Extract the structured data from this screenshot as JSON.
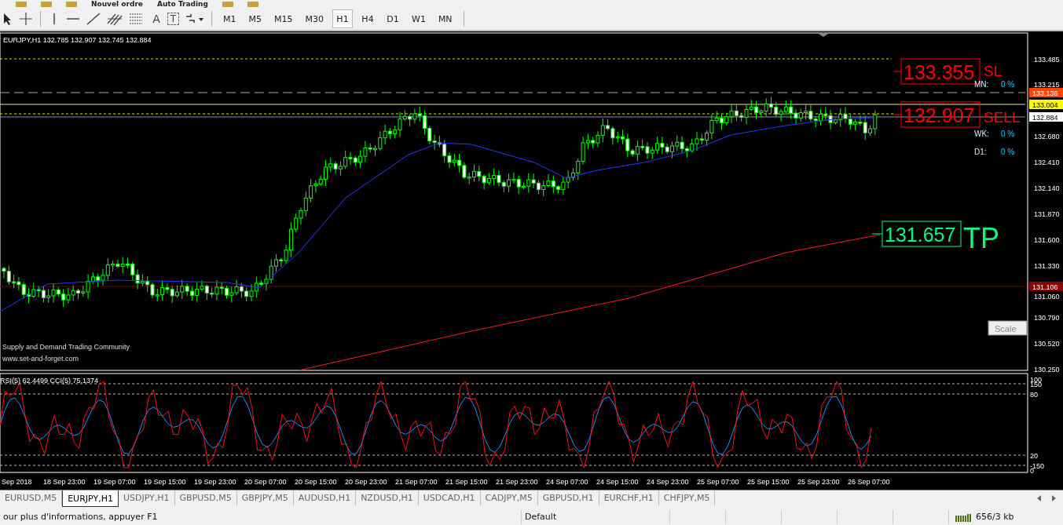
{
  "top_toolbar": {
    "labels": [
      "Nouvel ordre",
      "Auto Trading"
    ]
  },
  "toolbar": {
    "glyphs": [
      "A",
      "T"
    ],
    "timeframes": [
      {
        "label": "M1",
        "selected": false
      },
      {
        "label": "M5",
        "selected": false
      },
      {
        "label": "M15",
        "selected": false
      },
      {
        "label": "M30",
        "selected": false
      },
      {
        "label": "H1",
        "selected": true
      },
      {
        "label": "H4",
        "selected": false
      },
      {
        "label": "D1",
        "selected": false
      },
      {
        "label": "W1",
        "selected": false
      },
      {
        "label": "MN",
        "selected": false
      }
    ]
  },
  "chart": {
    "info": "EURJPY,H1  132.785 132.907 132.745 132.884",
    "price_axis": [
      "133.485",
      "133.215",
      "132.680",
      "132.410",
      "132.140",
      "131.870",
      "131.600",
      "131.330",
      "131.060",
      "130.790",
      "130.520",
      "130.250"
    ],
    "price_tags": [
      {
        "text": "133.136",
        "color": "#ff4500"
      },
      {
        "text": "133.004",
        "color": "#ffff00"
      },
      {
        "text": "132.884",
        "color": "#ffffff"
      },
      {
        "text": "131.106",
        "color": "#8b0000"
      }
    ],
    "orders": [
      {
        "price": "133.355",
        "tag": "SL",
        "color": "#ff0000"
      },
      {
        "price": "132.907",
        "tag": "SELL",
        "color": "#ff0000"
      },
      {
        "price": "131.657",
        "tag": "TP",
        "color": "#00ff7f"
      }
    ],
    "stats": [
      {
        "label": "MN:",
        "value": "0 %"
      },
      {
        "label": "WK:",
        "value": "0 %"
      },
      {
        "label": "D1:",
        "value": "0 %"
      }
    ],
    "notes": [
      "Supply and Demand Trading Community",
      "www.set-and-forget.com"
    ],
    "scale_button": "Scale"
  },
  "indicator": {
    "title": "RSI(5) 62.4499  CCI(5) 75.1374",
    "axis": [
      "100",
      "150",
      "80",
      "20",
      "-150",
      "0"
    ]
  },
  "time_axis": [
    "Sep 2018",
    "18 Sep 23:00",
    "19 Sep 07:00",
    "19 Sep 15:00",
    "19 Sep 23:00",
    "20 Sep 07:00",
    "20 Sep 15:00",
    "20 Sep 23:00",
    "21 Sep 07:00",
    "21 Sep 15:00",
    "21 Sep 23:00",
    "24 Sep 07:00",
    "24 Sep 15:00",
    "24 Sep 23:00",
    "25 Sep 07:00",
    "25 Sep 15:00",
    "25 Sep 23:00",
    "26 Sep 07:00"
  ],
  "tabs": [
    {
      "label": "EURUSD,M5",
      "selected": false
    },
    {
      "label": "EURJPY,H1",
      "selected": true
    },
    {
      "label": "USDJPY,H1",
      "selected": false
    },
    {
      "label": "GBPUSD,M5",
      "selected": false
    },
    {
      "label": "GBPJPY,M5",
      "selected": false
    },
    {
      "label": "AUDUSD,H1",
      "selected": false
    },
    {
      "label": "NZDUSD,H1",
      "selected": false
    },
    {
      "label": "USDCAD,H1",
      "selected": false
    },
    {
      "label": "CADJPY,M5",
      "selected": false
    },
    {
      "label": "GBPUSD,H1",
      "selected": false
    },
    {
      "label": "EURCHF,H1",
      "selected": false
    },
    {
      "label": "CHFJPY,M5",
      "selected": false
    }
  ],
  "status_bar": {
    "help": "our plus d'informations, appuyer F1",
    "profile": "Default",
    "traffic": "656/3 kb"
  }
}
